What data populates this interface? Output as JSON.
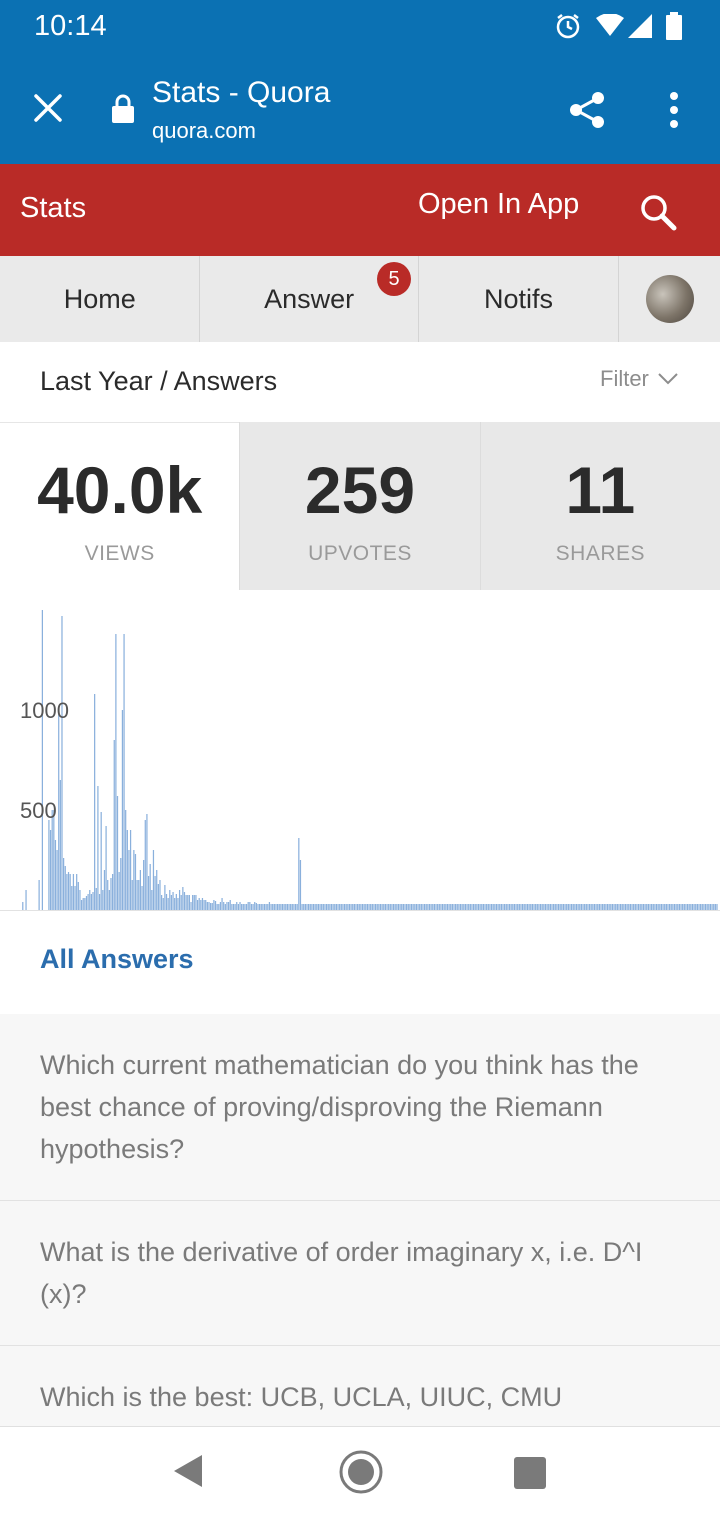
{
  "status_bar": {
    "time": "10:14"
  },
  "toolbar": {
    "title": "Stats - Quora",
    "url": "quora.com"
  },
  "red_bar": {
    "title": "Stats",
    "open_in_app": "Open In App"
  },
  "nav": {
    "tabs": [
      "Home",
      "Answer",
      "Notifs"
    ],
    "answer_badge": "5"
  },
  "filter": {
    "title": "Last Year / Answers",
    "label": "Filter"
  },
  "stats": [
    {
      "value": "40.0k",
      "label": "VIEWS",
      "active": true
    },
    {
      "value": "259",
      "label": "UPVOTES",
      "active": false
    },
    {
      "value": "11",
      "label": "SHARES",
      "active": false
    }
  ],
  "chart_data": {
    "type": "bar",
    "title": "",
    "xlabel": "",
    "ylabel": "",
    "ylim": [
      0,
      1500
    ],
    "yticks": [
      1000,
      500
    ],
    "color": "#8ab0dc",
    "values": [
      0,
      0,
      0,
      0,
      0,
      40,
      0,
      100,
      0,
      0,
      0,
      0,
      0,
      0,
      0,
      150,
      0,
      1500,
      0,
      0,
      0,
      450,
      400,
      500,
      500,
      350,
      300,
      1000,
      650,
      1470,
      260,
      220,
      180,
      190,
      180,
      120,
      180,
      120,
      180,
      140,
      100,
      50,
      60,
      60,
      70,
      80,
      100,
      80,
      90,
      1080,
      110,
      620,
      80,
      490,
      100,
      200,
      420,
      150,
      100,
      160,
      180,
      850,
      1380,
      570,
      190,
      260,
      1000,
      1380,
      500,
      400,
      300,
      400,
      150,
      300,
      280,
      150,
      150,
      200,
      120,
      250,
      450,
      480,
      170,
      230,
      100,
      300,
      170,
      200,
      130,
      150,
      75,
      60,
      125,
      80,
      60,
      100,
      75,
      90,
      60,
      80,
      60,
      100,
      75,
      115,
      90,
      75,
      75,
      75,
      40,
      75,
      75,
      75,
      50,
      60,
      50,
      60,
      50,
      50,
      40,
      40,
      35,
      35,
      50,
      45,
      30,
      30,
      40,
      60,
      40,
      30,
      40,
      40,
      50,
      30,
      30,
      30,
      40,
      30,
      40,
      30,
      30,
      30,
      30,
      40,
      40,
      30,
      30,
      40,
      35,
      30,
      30,
      30,
      30,
      30,
      30,
      30,
      40,
      30,
      30,
      30,
      30,
      30,
      30,
      30,
      30,
      30,
      30,
      30,
      30,
      30,
      30,
      30,
      30,
      30,
      360,
      250,
      30,
      30,
      30,
      30,
      30,
      30,
      30,
      30,
      30,
      30,
      30,
      30,
      30,
      30,
      30,
      30,
      30,
      30,
      30,
      30,
      30,
      30,
      30,
      30,
      30,
      30,
      30,
      30,
      30,
      30,
      30,
      30,
      30,
      30,
      30,
      30,
      30,
      30,
      30,
      30,
      30,
      30,
      30,
      30,
      30,
      30,
      30,
      30,
      30,
      30,
      30,
      30,
      30,
      30,
      30,
      30,
      30,
      30,
      30,
      30,
      30,
      30,
      30,
      30,
      30,
      30,
      30,
      30,
      30,
      30,
      30,
      30,
      30,
      30,
      30,
      30,
      30,
      30,
      30,
      30,
      30,
      30,
      30,
      30,
      30,
      30,
      30,
      30,
      30,
      30,
      30,
      30,
      30,
      30,
      30,
      30,
      30,
      30,
      30,
      30,
      30,
      30,
      30,
      30,
      30,
      30,
      30,
      30,
      30,
      30,
      30,
      30,
      30,
      30,
      30,
      30,
      30,
      30,
      30,
      30,
      30,
      30,
      30,
      30,
      30,
      30,
      30,
      30,
      30,
      30,
      30,
      30,
      30,
      30,
      30,
      30,
      30,
      30,
      30,
      30,
      30,
      30,
      30,
      30,
      30,
      30,
      30,
      30,
      30,
      30,
      30,
      30,
      30,
      30,
      30,
      30,
      30,
      30,
      30,
      30,
      30,
      30,
      30,
      30,
      30,
      30,
      30,
      30,
      30,
      30,
      30,
      30,
      30,
      30,
      30,
      30,
      30,
      30,
      30,
      30,
      30,
      30,
      30,
      30,
      30,
      30,
      30,
      30,
      30,
      30,
      30,
      30,
      30,
      30,
      30,
      30,
      30,
      30,
      30,
      30,
      30,
      30,
      30,
      30,
      30,
      30,
      30,
      30,
      30,
      30,
      30,
      30,
      30,
      30,
      30,
      30,
      30,
      30,
      30,
      30,
      30,
      30,
      30,
      30,
      30,
      30,
      30,
      30,
      30,
      30,
      30,
      30,
      30,
      30,
      30,
      30,
      30,
      30,
      30,
      30,
      30,
      30,
      30,
      30,
      30,
      30,
      30,
      30,
      30,
      30,
      30,
      30,
      30,
      30,
      30
    ]
  },
  "all_answers_label": "All Answers",
  "answers": [
    "Which current mathematician do you think has the best chance of proving/disproving the Riemann hypothesis?",
    "What is the derivative of order imaginary x, i.e. D^I (x)?",
    "Which is the best: UCB, UCLA, UIUC, CMU"
  ],
  "colors": {
    "quora_red": "#b92b27",
    "toolbar_blue": "#0b71b3",
    "link_blue": "#2b6dad"
  }
}
